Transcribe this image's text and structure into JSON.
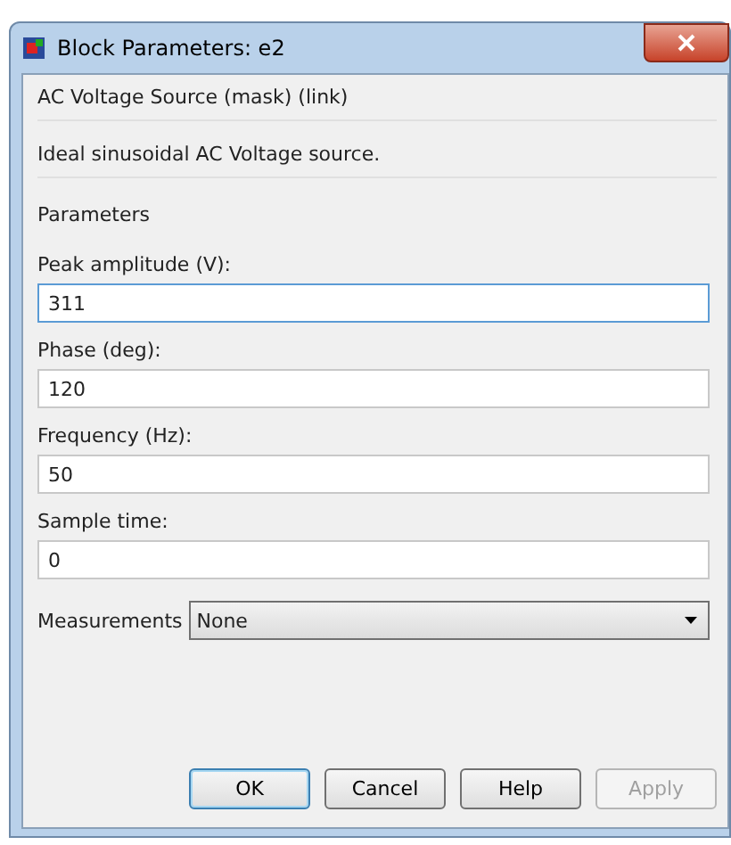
{
  "window": {
    "title": "Block Parameters: e2"
  },
  "block_type": "AC Voltage Source (mask) (link)",
  "description": "Ideal sinusoidal AC Voltage source.",
  "section": "Parameters",
  "parameters": [
    {
      "label": "Peak amplitude (V):",
      "value": "311",
      "focused": true
    },
    {
      "label": "Phase (deg):",
      "value": "120",
      "focused": false
    },
    {
      "label": "Frequency (Hz):",
      "value": "50",
      "focused": false
    },
    {
      "label": "Sample time:",
      "value": "0",
      "focused": false
    }
  ],
  "measurements": {
    "label": "Measurements",
    "value": "None"
  },
  "buttons": [
    {
      "label": "OK",
      "default": true,
      "disabled": false
    },
    {
      "label": "Cancel",
      "default": false,
      "disabled": false
    },
    {
      "label": "Help",
      "default": false,
      "disabled": false
    },
    {
      "label": "Apply",
      "default": false,
      "disabled": true
    }
  ]
}
